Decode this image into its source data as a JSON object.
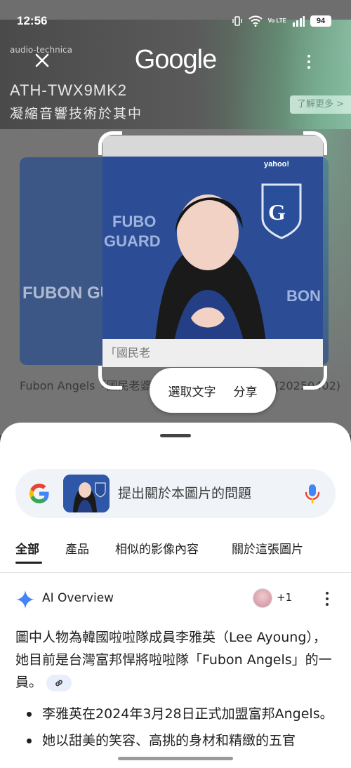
{
  "status_bar": {
    "time": "12:56",
    "battery": "94",
    "network": "Vo LTE"
  },
  "background": {
    "brand": "audio-technica",
    "product_model": "ATH-TWX9MK2",
    "product_tagline": "凝縮音響技術於其中",
    "more_button": "了解更多 >",
    "photo_text": "FUBON GUARDIANS",
    "caption": "Fubon Angels「國民老婆」李雅英（呂權紘 / 攝）(20250402)"
  },
  "lens_header": {
    "logo": "Google"
  },
  "selection_actions": {
    "select_text": "選取文字",
    "share": "分享"
  },
  "search": {
    "placeholder": "提出關於本圖片的問題"
  },
  "tabs": [
    {
      "label": "全部",
      "active": true
    },
    {
      "label": "產品",
      "active": false
    },
    {
      "label": "相似的影像內容",
      "active": false
    },
    {
      "label": "關於這張圖片",
      "active": false
    }
  ],
  "ai_overview": {
    "title": "AI Overview",
    "source_count": "+1",
    "paragraph": "圖中人物為韓國啦啦隊成員李雅英（Lee Ayoung），她目前是台灣富邦悍將啦啦隊「Fubon Angels」的一員。",
    "bullets": [
      "李雅英在2024年3月28日正式加盟富邦Angels。",
      "她以甜美的笑容、高挑的身材和精緻的五官"
    ]
  },
  "colors": {
    "accent_blue": "#4285F4",
    "sheet_bg": "#ffffff",
    "search_bg": "#f0f3f8"
  }
}
